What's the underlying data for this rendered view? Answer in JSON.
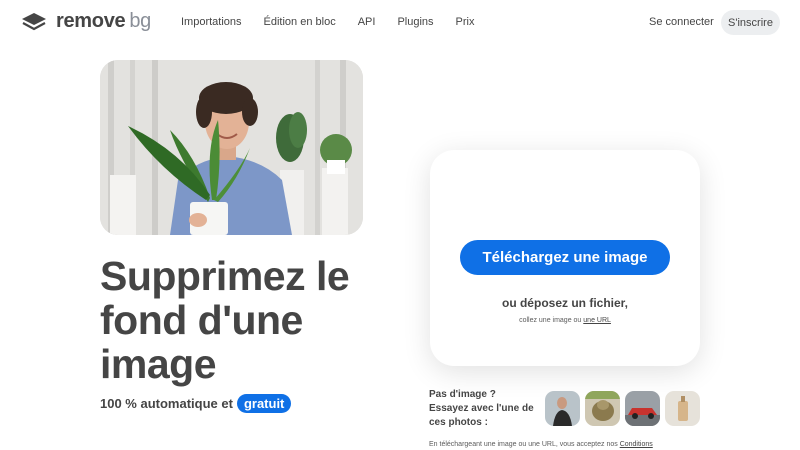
{
  "logo": {
    "word1": "remove",
    "word2": "bg"
  },
  "nav": {
    "links": [
      "Importations",
      "Édition en bloc",
      "API",
      "Plugins",
      "Prix"
    ],
    "signin": "Se connecter",
    "signup": "S'inscrire"
  },
  "hero": {
    "title_line1": "Supprimez le",
    "title_line2": "fond d'une",
    "title_line3": "image",
    "subtitle": "100 % automatique et",
    "badge": "gratuit"
  },
  "upload": {
    "button": "Téléchargez une image",
    "drop": "ou déposez un fichier,",
    "paste_prefix": "collez une image ou",
    "paste_link": "une URL"
  },
  "samples": {
    "line1": "Pas d'image ?",
    "line2": "Essayez avec l'une de",
    "line3": "ces photos :"
  },
  "legal": {
    "text": "En téléchargeant une image ou une URL, vous acceptez nos",
    "link": "Conditions"
  },
  "colors": {
    "accent": "#0f70e6",
    "text": "#454545"
  }
}
